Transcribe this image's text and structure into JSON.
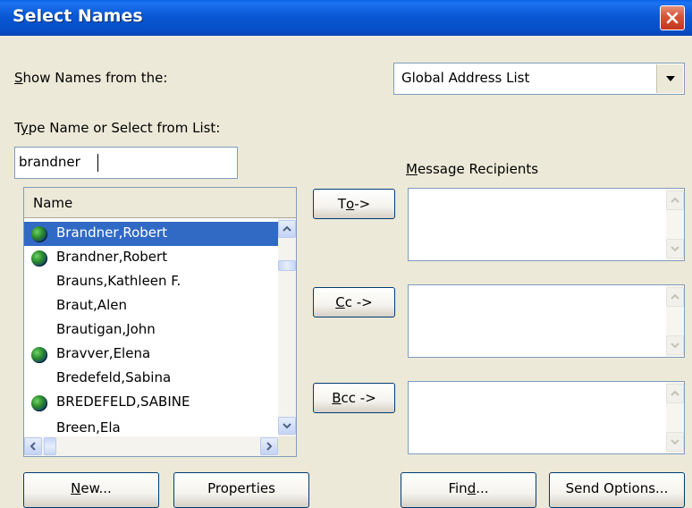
{
  "window": {
    "title": "Select Names"
  },
  "show_names": {
    "label_prefix": "",
    "label_underlined": "S",
    "label_rest": "how Names from the:",
    "selected": "Global Address List"
  },
  "type_name": {
    "label_prefix": "T",
    "label_underlined": "y",
    "label_rest": "pe Name or Select from List:",
    "value": "brandner"
  },
  "name_list": {
    "column_header": "Name",
    "rows": [
      {
        "name": "Brandner,Robert",
        "icon": "globe-icon",
        "selected": true
      },
      {
        "name": "Brandner,Robert",
        "icon": "globe-icon",
        "selected": false
      },
      {
        "name": "Brauns,Kathleen F.",
        "icon": "",
        "selected": false
      },
      {
        "name": "Braut,Alen",
        "icon": "",
        "selected": false
      },
      {
        "name": "Brautigan,John",
        "icon": "",
        "selected": false
      },
      {
        "name": "Bravver,Elena",
        "icon": "globe-icon",
        "selected": false
      },
      {
        "name": "Bredefeld,Sabina",
        "icon": "",
        "selected": false
      },
      {
        "name": "BREDEFELD,SABINE",
        "icon": "globe-icon",
        "selected": false
      },
      {
        "name": "Breen,Ela",
        "icon": "",
        "selected": false
      }
    ]
  },
  "recipients": {
    "label_prefix": "",
    "label_underlined": "M",
    "label_rest": "essage Recipients",
    "to_prefix": "T",
    "to_underlined": "o",
    "to_rest": " ->",
    "cc_prefix": "",
    "cc_underlined": "C",
    "cc_rest": "c ->",
    "bcc_prefix": "",
    "bcc_underlined": "B",
    "bcc_rest": "cc ->"
  },
  "buttons": {
    "new_prefix": "",
    "new_underlined": "N",
    "new_rest": "ew...",
    "properties": "Properties",
    "find_prefix": "Fin",
    "find_underlined": "d",
    "find_rest": "...",
    "send_options": "Send Options..."
  },
  "colors": {
    "title_bar": "#0a58d6",
    "selection": "#316ac5",
    "face": "#ece9d8",
    "close": "#c2351d"
  }
}
